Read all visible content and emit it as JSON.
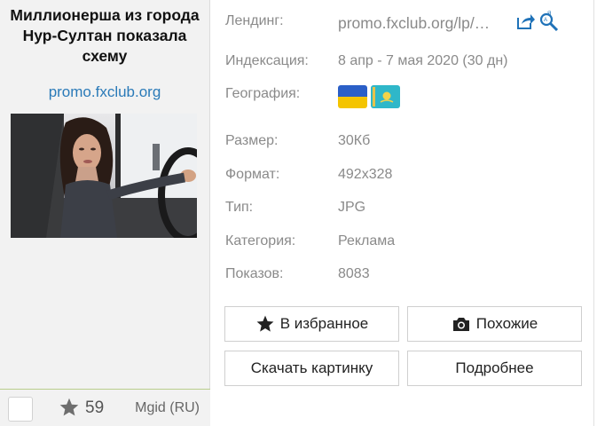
{
  "card": {
    "title": "Миллионерша из города Нур-Султан показала схему",
    "domain": "promo.fxclub.org",
    "count": "59",
    "network": "Mgid (RU)"
  },
  "details": {
    "landing_label": "Лендинг:",
    "landing_value": "promo.fxclub.org/lp/…",
    "indexing_label": "Индексация:",
    "indexing_value": "8 апр - 7 мая 2020 (30 дн)",
    "geo_label": "География:",
    "geo_flags": [
      "Ukraine",
      "Kazakhstan"
    ],
    "size_label": "Размер:",
    "size_value": "30Кб",
    "format_label": "Формат:",
    "format_value": "492x328",
    "type_label": "Тип:",
    "type_value": "JPG",
    "category_label": "Категория:",
    "category_value": "Реклама",
    "views_label": "Показов:",
    "views_value": "8083"
  },
  "actions": {
    "favorite": "В избранное",
    "similar": "Похожие",
    "download": "Скачать картинку",
    "more": "Подробнее"
  },
  "colors": {
    "accent_link": "#2a7ab8",
    "icon_blue": "#1f72b8",
    "footer_border": "#b9ce8c"
  }
}
